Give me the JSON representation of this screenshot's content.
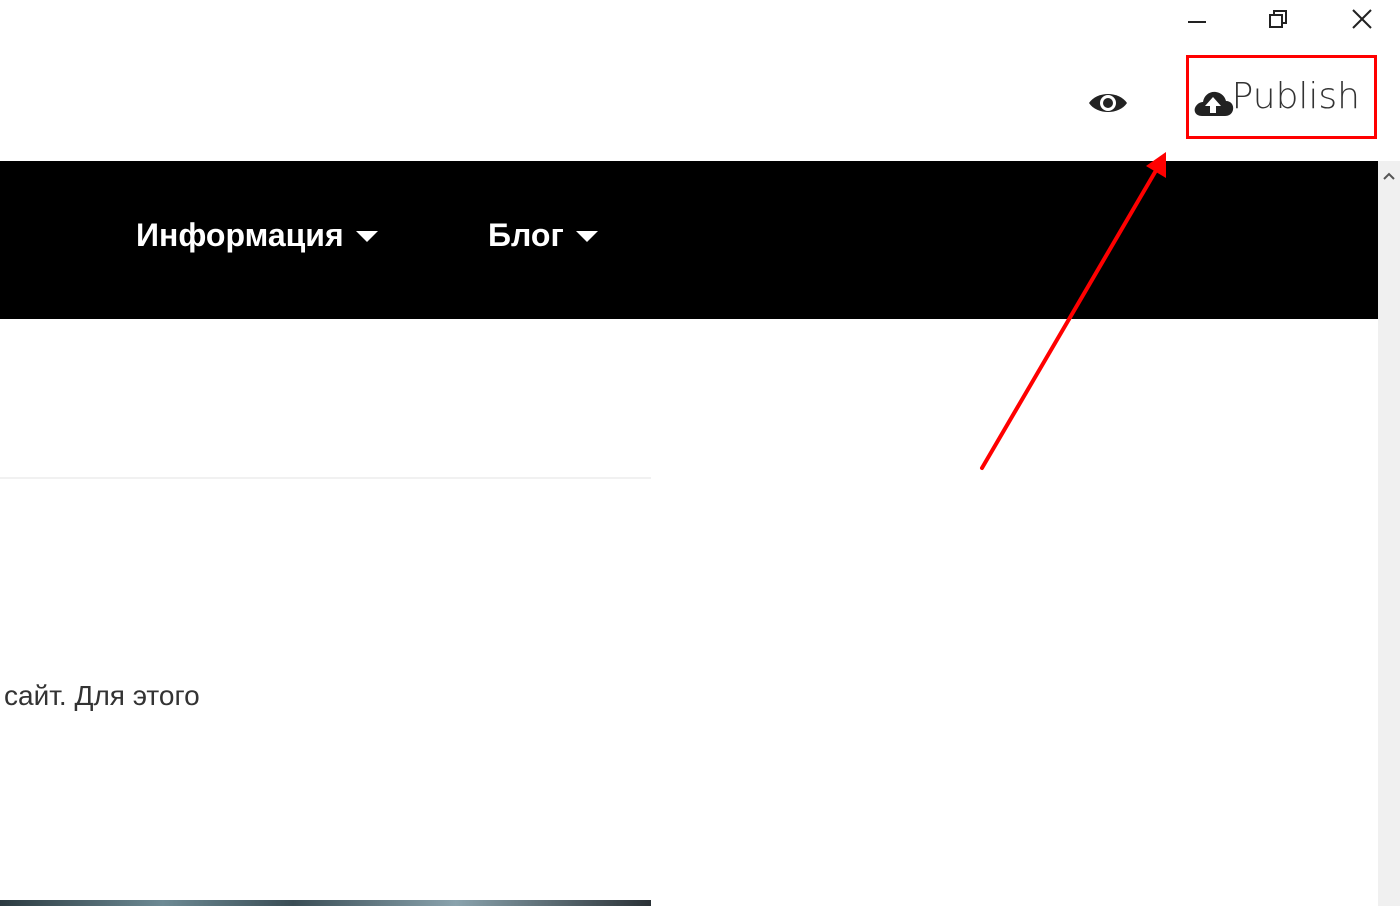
{
  "window_controls": {
    "minimize_icon": "minimize-icon",
    "maximize_icon": "restore-icon",
    "close_icon": "close-icon"
  },
  "toolbar": {
    "preview_icon": "eye-icon",
    "publish_icon": "cloud-upload-icon",
    "publish_label": "Publish"
  },
  "navbar": {
    "items": [
      {
        "label": "Информация"
      },
      {
        "label": "Блог"
      }
    ]
  },
  "content": {
    "text": "сайт. Для этого"
  },
  "colors": {
    "navbar_bg": "#000000",
    "annotation": "#ff0000",
    "text": "#333333"
  }
}
